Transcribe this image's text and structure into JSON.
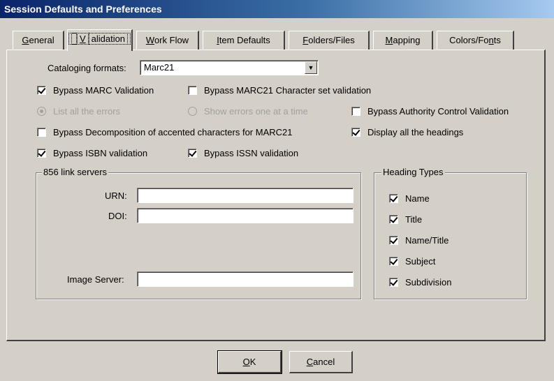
{
  "window": {
    "title": "Session Defaults and Preferences"
  },
  "tabs": [
    {
      "pre": "",
      "ul": "G",
      "post": "eneral"
    },
    {
      "pre": "",
      "ul": "V",
      "post": "alidation"
    },
    {
      "pre": "",
      "ul": "W",
      "post": "ork Flow"
    },
    {
      "pre": "",
      "ul": "I",
      "post": "tem Defaults"
    },
    {
      "pre": "",
      "ul": "F",
      "post": "olders/Files"
    },
    {
      "pre": "",
      "ul": "M",
      "post": "apping"
    },
    {
      "pre": "Colors/Fo",
      "ul": "n",
      "post": "ts"
    }
  ],
  "active_tab": "Validation",
  "cataloging": {
    "label": "Cataloging formats:",
    "value": "Marc21"
  },
  "options": {
    "bypass_marc": {
      "label": "Bypass MARC Validation",
      "checked": true
    },
    "bypass_marc21_charset": {
      "label": "Bypass MARC21 Character set validation",
      "checked": false
    },
    "list_errors": {
      "label": "List all the errors",
      "checked": true,
      "disabled": true
    },
    "show_errors": {
      "label": "Show errors one at a time",
      "checked": false,
      "disabled": true
    },
    "bypass_authority": {
      "label": "Bypass Authority Control Validation",
      "checked": false
    },
    "bypass_decomp": {
      "label": "Bypass Decomposition of accented characters for MARC21",
      "checked": false
    },
    "display_headings": {
      "label": "Display all the headings",
      "checked": true
    },
    "bypass_isbn": {
      "label": "Bypass ISBN validation",
      "checked": true
    },
    "bypass_issn": {
      "label": "Bypass ISSN validation",
      "checked": true
    }
  },
  "link_servers": {
    "title": "856 link servers",
    "urn_label": "URN:",
    "urn_value": "",
    "doi_label": "DOI:",
    "doi_value": "",
    "image_label": "Image Server:",
    "image_value": ""
  },
  "heading_types": {
    "title": "Heading Types",
    "items": [
      {
        "label": "Name",
        "checked": true
      },
      {
        "label": "Title",
        "checked": true
      },
      {
        "label": "Name/Title",
        "checked": true
      },
      {
        "label": "Subject",
        "checked": true
      },
      {
        "label": "Subdivision",
        "checked": true
      }
    ]
  },
  "buttons": {
    "ok": {
      "ul": "O",
      "post": "K"
    },
    "cancel": {
      "ul": "C",
      "post": "ancel"
    }
  }
}
